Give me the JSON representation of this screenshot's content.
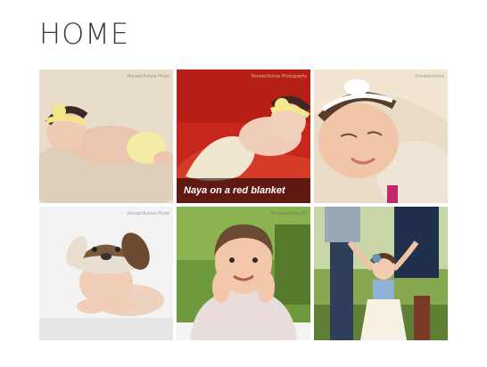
{
  "page": {
    "title": "HOME"
  },
  "gallery": {
    "photos": [
      {
        "alt": "Sleeping newborn in yellow headband on cream blanket",
        "watermark": "RenataVictoria Photo",
        "caption": ""
      },
      {
        "alt": "Baby in yellow headband sleeping on red blanket",
        "watermark": "RenataVictoria Photography",
        "caption": "Naya on a red blanket"
      },
      {
        "alt": "Smiling sleeping newborn with white bow",
        "watermark": "RenataVictoria",
        "caption": ""
      },
      {
        "alt": "Newborn in knit puppy hat resting chin on hands",
        "watermark": "RenataVictoria Photo",
        "caption": ""
      },
      {
        "alt": "Toddler girl smiling with hands on cheeks",
        "watermark": "RenataVictoria Ph",
        "caption": ""
      },
      {
        "alt": "Toddler girl in tutu holding parents' hands",
        "watermark": "",
        "caption": ""
      }
    ]
  },
  "colors": {
    "title": "#3a3a3a",
    "caption_bg": "rgba(0,0,0,0.55)"
  }
}
